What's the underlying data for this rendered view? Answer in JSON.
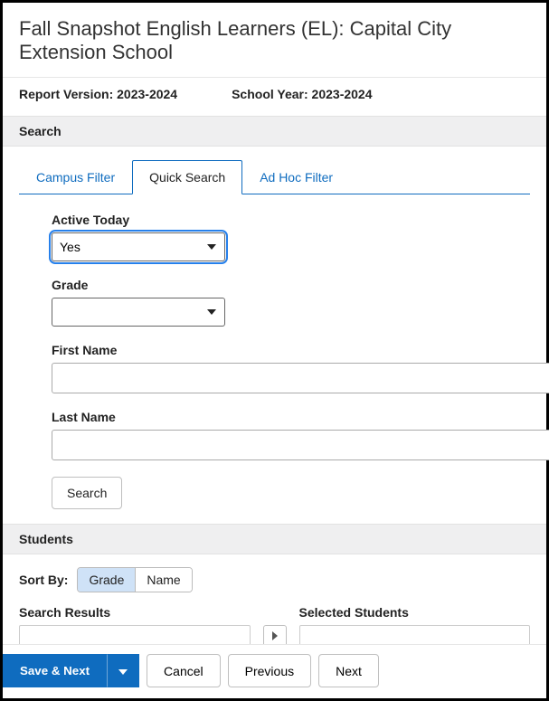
{
  "page": {
    "title": "Fall Snapshot English Learners (EL): Capital City Extension School"
  },
  "meta": {
    "report_version_label": "Report Version:",
    "report_version_value": "2023-2024",
    "school_year_label": "School Year:",
    "school_year_value": "2023-2024"
  },
  "sections": {
    "search_header": "Search",
    "students_header": "Students"
  },
  "tabs": {
    "campus_filter": "Campus Filter",
    "quick_search": "Quick Search",
    "ad_hoc_filter": "Ad Hoc Filter"
  },
  "form": {
    "active_today_label": "Active Today",
    "active_today_value": "Yes",
    "grade_label": "Grade",
    "grade_value": "",
    "first_name_label": "First Name",
    "first_name_value": "",
    "last_name_label": "Last Name",
    "last_name_value": "",
    "search_button": "Search"
  },
  "sort": {
    "label": "Sort By:",
    "grade": "Grade",
    "name": "Name"
  },
  "lists": {
    "search_results_label": "Search Results",
    "selected_students_label": "Selected Students"
  },
  "footer": {
    "save_next": "Save & Next",
    "cancel": "Cancel",
    "previous": "Previous",
    "next": "Next"
  }
}
